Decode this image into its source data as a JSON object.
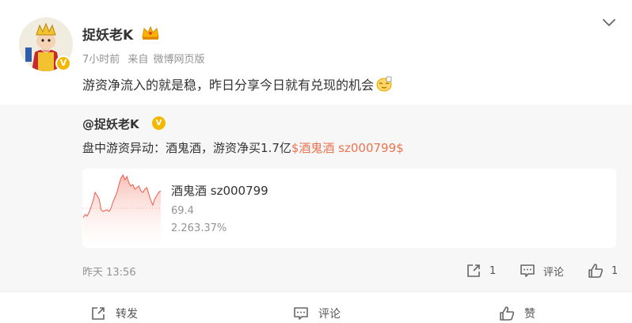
{
  "post": {
    "author": "捉妖老K",
    "time": "7小时前",
    "source_prefix": "来自",
    "source": "微博网页版",
    "text": "游资净流入的就是稳，昨日分享今日就有兑现的机会"
  },
  "repost": {
    "author": "@捉妖老K",
    "text": "盘中游资异动：酒鬼酒，游资净买1.7亿",
    "link_text": "$酒鬼酒 sz000799$",
    "stock_card": {
      "name": "酒鬼酒 sz000799",
      "price": "69.4",
      "change": "2.263.37%"
    },
    "time": "昨天 13:56",
    "share_count": "1",
    "comment_label": "评论",
    "like_count": "1"
  },
  "actions": {
    "share_label": "转发",
    "comment_label": "评论",
    "like_label": "赞"
  },
  "colors": {
    "link": "#eb7350",
    "badge": "#f5b800",
    "chart_line": "#f15b4b"
  },
  "icons": [
    "more-chevron-icon",
    "vip-crown-icon",
    "verified-badge-icon",
    "emoji-icon",
    "share-icon",
    "comment-icon",
    "like-icon"
  ]
}
